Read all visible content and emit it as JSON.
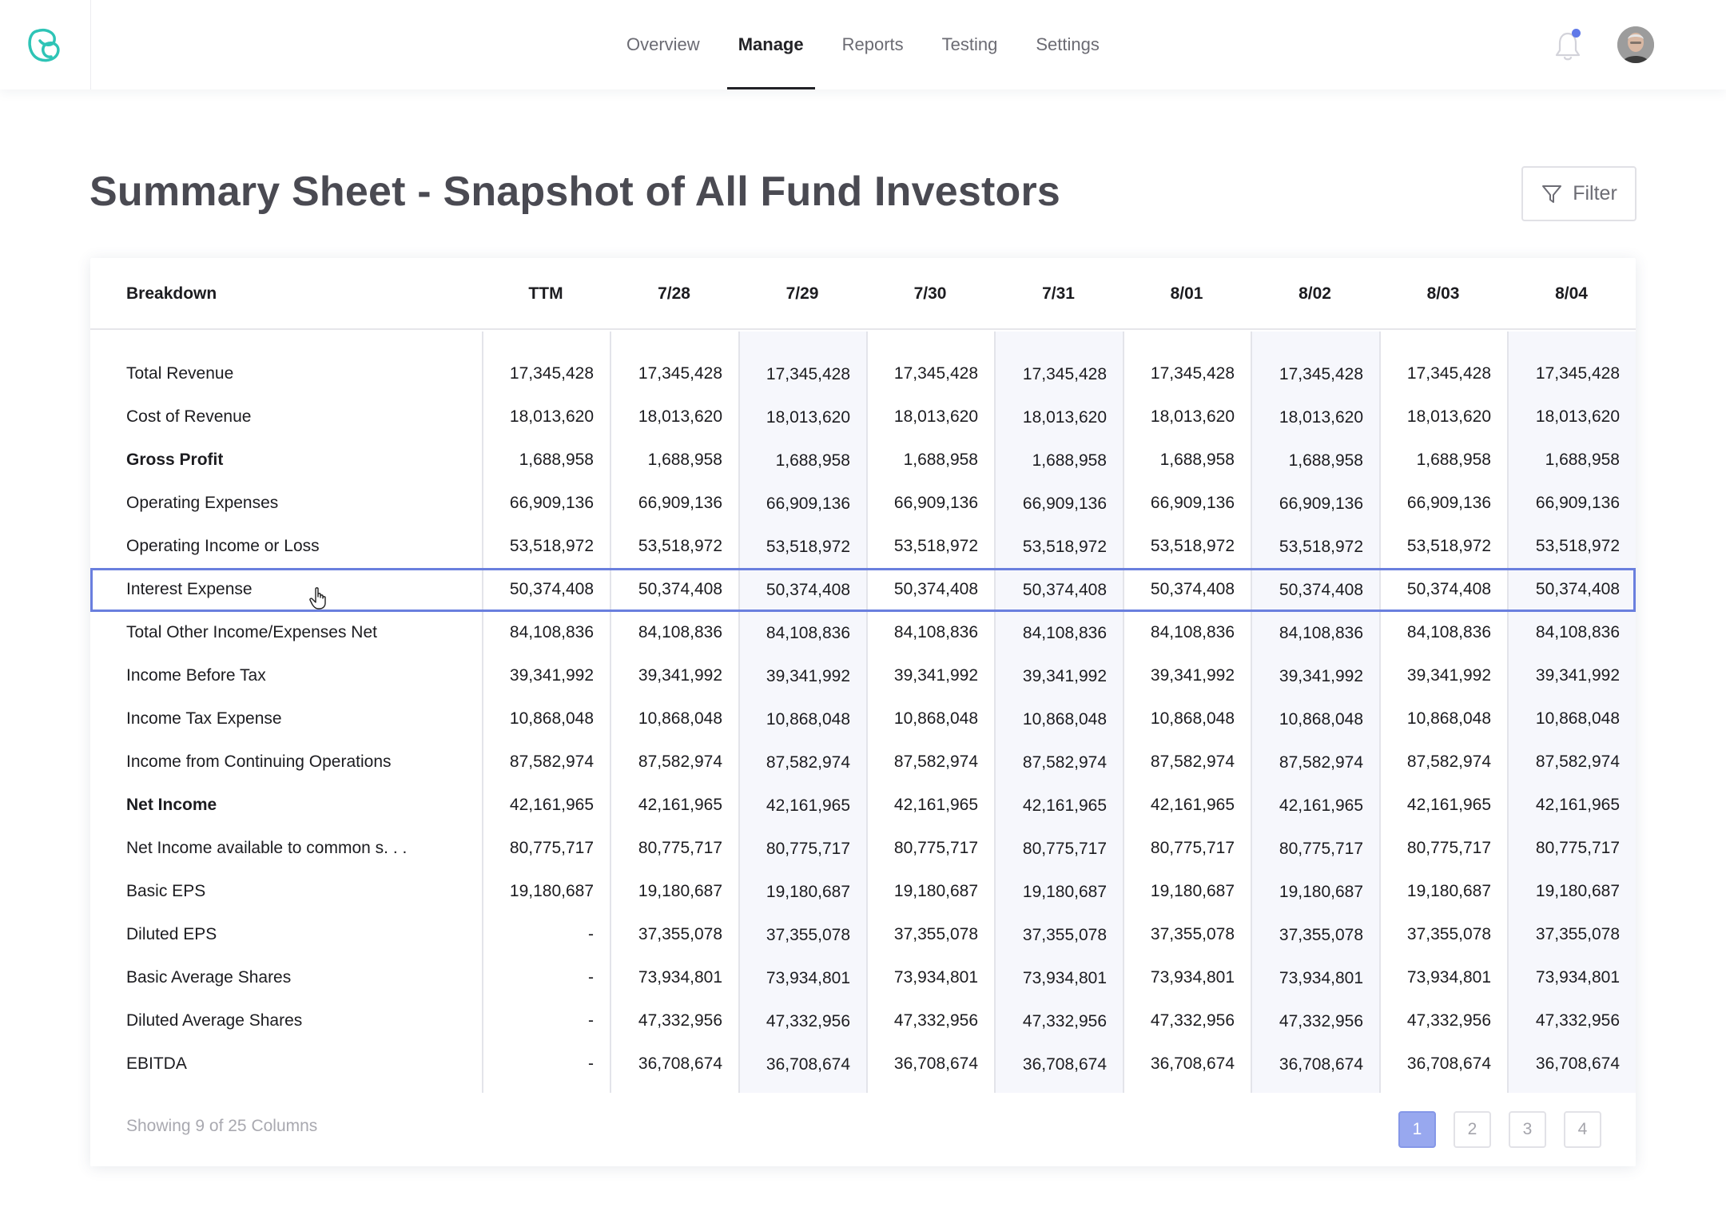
{
  "nav": {
    "tabs": [
      {
        "label": "Overview",
        "active": false
      },
      {
        "label": "Manage",
        "active": true
      },
      {
        "label": "Reports",
        "active": false
      },
      {
        "label": "Testing",
        "active": false
      },
      {
        "label": "Settings",
        "active": false
      }
    ],
    "logo_icon": "brand-logo-icon",
    "notification_icon": "bell-icon",
    "has_unread_notifications": true
  },
  "page": {
    "title": "Summary Sheet - Snapshot of All Fund Investors",
    "filter_label": "Filter",
    "filter_icon": "funnel-icon"
  },
  "table": {
    "headers": [
      "Breakdown",
      "TTM",
      "7/28",
      "7/29",
      "7/30",
      "7/31",
      "8/01",
      "8/02",
      "8/03",
      "8/04"
    ],
    "rows": [
      {
        "label": "Total Revenue",
        "bold": false,
        "values": [
          "17,345,428",
          "17,345,428",
          "17,345,428",
          "17,345,428",
          "17,345,428",
          "17,345,428",
          "17,345,428",
          "17,345,428",
          "17,345,428"
        ]
      },
      {
        "label": "Cost of Revenue",
        "bold": false,
        "values": [
          "18,013,620",
          "18,013,620",
          "18,013,620",
          "18,013,620",
          "18,013,620",
          "18,013,620",
          "18,013,620",
          "18,013,620",
          "18,013,620"
        ]
      },
      {
        "label": "Gross Profit",
        "bold": true,
        "values": [
          "1,688,958",
          "1,688,958",
          "1,688,958",
          "1,688,958",
          "1,688,958",
          "1,688,958",
          "1,688,958",
          "1,688,958",
          "1,688,958"
        ]
      },
      {
        "label": "Operating Expenses",
        "bold": false,
        "values": [
          "66,909,136",
          "66,909,136",
          "66,909,136",
          "66,909,136",
          "66,909,136",
          "66,909,136",
          "66,909,136",
          "66,909,136",
          "66,909,136"
        ]
      },
      {
        "label": "Operating Income or Loss",
        "bold": false,
        "values": [
          "53,518,972",
          "53,518,972",
          "53,518,972",
          "53,518,972",
          "53,518,972",
          "53,518,972",
          "53,518,972",
          "53,518,972",
          "53,518,972"
        ]
      },
      {
        "label": "Interest Expense",
        "bold": false,
        "selected": true,
        "values": [
          "50,374,408",
          "50,374,408",
          "50,374,408",
          "50,374,408",
          "50,374,408",
          "50,374,408",
          "50,374,408",
          "50,374,408",
          "50,374,408"
        ]
      },
      {
        "label": "Total Other Income/Expenses Net",
        "bold": false,
        "values": [
          "84,108,836",
          "84,108,836",
          "84,108,836",
          "84,108,836",
          "84,108,836",
          "84,108,836",
          "84,108,836",
          "84,108,836",
          "84,108,836"
        ]
      },
      {
        "label": "Income Before Tax",
        "bold": false,
        "values": [
          "39,341,992",
          "39,341,992",
          "39,341,992",
          "39,341,992",
          "39,341,992",
          "39,341,992",
          "39,341,992",
          "39,341,992",
          "39,341,992"
        ]
      },
      {
        "label": "Income Tax Expense",
        "bold": false,
        "values": [
          "10,868,048",
          "10,868,048",
          "10,868,048",
          "10,868,048",
          "10,868,048",
          "10,868,048",
          "10,868,048",
          "10,868,048",
          "10,868,048"
        ]
      },
      {
        "label": "Income from Continuing Operations",
        "bold": false,
        "values": [
          "87,582,974",
          "87,582,974",
          "87,582,974",
          "87,582,974",
          "87,582,974",
          "87,582,974",
          "87,582,974",
          "87,582,974",
          "87,582,974"
        ]
      },
      {
        "label": "Net Income",
        "bold": true,
        "values": [
          "42,161,965",
          "42,161,965",
          "42,161,965",
          "42,161,965",
          "42,161,965",
          "42,161,965",
          "42,161,965",
          "42,161,965",
          "42,161,965"
        ]
      },
      {
        "label": "Net Income available to common s. . .",
        "bold": false,
        "values": [
          "80,775,717",
          "80,775,717",
          "80,775,717",
          "80,775,717",
          "80,775,717",
          "80,775,717",
          "80,775,717",
          "80,775,717",
          "80,775,717"
        ]
      },
      {
        "label": "Basic EPS",
        "bold": false,
        "values": [
          "19,180,687",
          "19,180,687",
          "19,180,687",
          "19,180,687",
          "19,180,687",
          "19,180,687",
          "19,180,687",
          "19,180,687",
          "19,180,687"
        ]
      },
      {
        "label": "Diluted EPS",
        "bold": false,
        "values": [
          "-",
          "37,355,078",
          "37,355,078",
          "37,355,078",
          "37,355,078",
          "37,355,078",
          "37,355,078",
          "37,355,078",
          "37,355,078"
        ]
      },
      {
        "label": "Basic Average Shares",
        "bold": false,
        "values": [
          "-",
          "73,934,801",
          "73,934,801",
          "73,934,801",
          "73,934,801",
          "73,934,801",
          "73,934,801",
          "73,934,801",
          "73,934,801"
        ]
      },
      {
        "label": "Diluted Average Shares",
        "bold": false,
        "values": [
          "-",
          "47,332,956",
          "47,332,956",
          "47,332,956",
          "47,332,956",
          "47,332,956",
          "47,332,956",
          "47,332,956",
          "47,332,956"
        ]
      },
      {
        "label": "EBITDA",
        "bold": false,
        "values": [
          "-",
          "36,708,674",
          "36,708,674",
          "36,708,674",
          "36,708,674",
          "36,708,674",
          "36,708,674",
          "36,708,674",
          "36,708,674"
        ]
      }
    ]
  },
  "footer": {
    "showing_text": "Showing 9 of 25 Columns",
    "pages": [
      "1",
      "2",
      "3",
      "4"
    ],
    "current_page": "1"
  },
  "colors": {
    "accent": "#6a7fde",
    "active_page": "#98a8ef",
    "shaded_column": "#f6f7fc",
    "logo": "#2ec4b6",
    "notification_dot": "#5f78e8"
  }
}
